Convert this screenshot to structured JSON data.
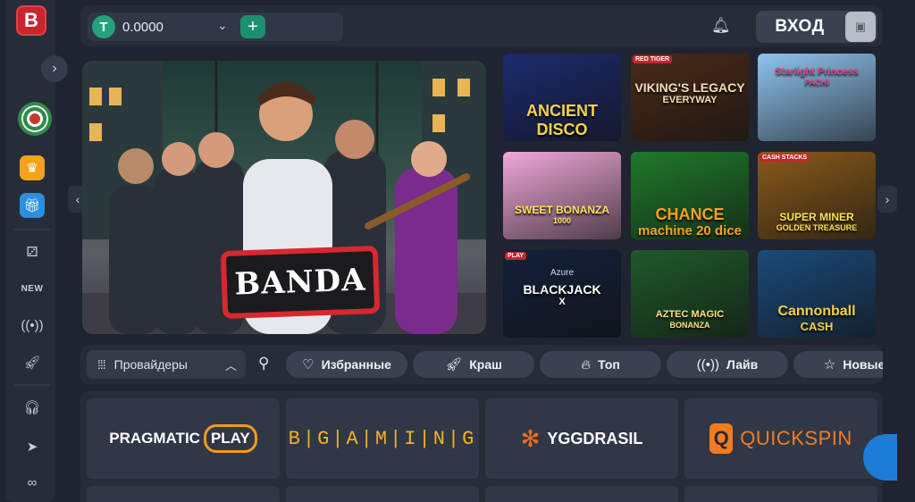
{
  "sidebar": {
    "logo_letter": "B",
    "items": [
      {
        "icon": "crown-icon",
        "color": "#f4a21b"
      },
      {
        "icon": "gift-icon",
        "color": "#2a8fe0"
      },
      {
        "icon": "dice-icon"
      },
      {
        "icon": "new-icon",
        "label": "NEW"
      },
      {
        "icon": "live-icon"
      },
      {
        "icon": "rocket-icon"
      },
      {
        "icon": "support-icon"
      },
      {
        "icon": "telegram-icon"
      },
      {
        "icon": "link-icon"
      }
    ]
  },
  "topbar": {
    "balance": "0.0000",
    "currency_icon": "T",
    "login_label": "ВХОД"
  },
  "banner": {
    "title": "BANDA"
  },
  "games": [
    {
      "title": "ANCIENT DISCO",
      "bg": "#1c2b6e"
    },
    {
      "title": "VIKING'S LEGACY",
      "sub": "EVERYWAY",
      "badge": "RED TIGER",
      "bg": "#4a2a18"
    },
    {
      "title": "Starlight Princess",
      "sub": "PACHI",
      "bg": "#8fc4f0"
    },
    {
      "title": "SWEET BONANZA",
      "sub": "1000",
      "bg": "#f0a8d8"
    },
    {
      "title": "CHANCE",
      "sub": "machine 20 dice",
      "bg": "#1f7a2a"
    },
    {
      "title": "SUPER MINER",
      "sub": "GOLDEN TREASURE",
      "badge": "CASH STACKS",
      "bg": "#8a5a1a"
    },
    {
      "title": "BLACKJACK",
      "pre": "Azure",
      "sub": "X",
      "badge": "PLAY",
      "bg": "#12203a"
    },
    {
      "title": "AZTEC MAGIC",
      "sub": "BONANZA",
      "bg": "#1f5a2a"
    },
    {
      "title": "Cannonball",
      "sub": "CASH",
      "bg": "#1a4a7a"
    }
  ],
  "filters": {
    "providers_label": "Провайдеры",
    "pills": [
      {
        "label": "Избранные",
        "icon": "heart-icon"
      },
      {
        "label": "Краш",
        "icon": "rocket-icon"
      },
      {
        "label": "Топ",
        "icon": "fire-icon"
      },
      {
        "label": "Лайв",
        "icon": "live-icon"
      },
      {
        "label": "Новые",
        "icon": "star-icon"
      }
    ]
  },
  "providers": [
    {
      "name": "PRAGMATIC PLAY",
      "part1": "PRAGMATIC",
      "part2": "PLAY"
    },
    {
      "name": "BGAMING",
      "text": "B|G|A|M|I|N|G"
    },
    {
      "name": "YGGDRASIL",
      "text": "YGGDRASIL"
    },
    {
      "name": "QUICKSPIN",
      "text": "QUICKSPIN"
    }
  ]
}
